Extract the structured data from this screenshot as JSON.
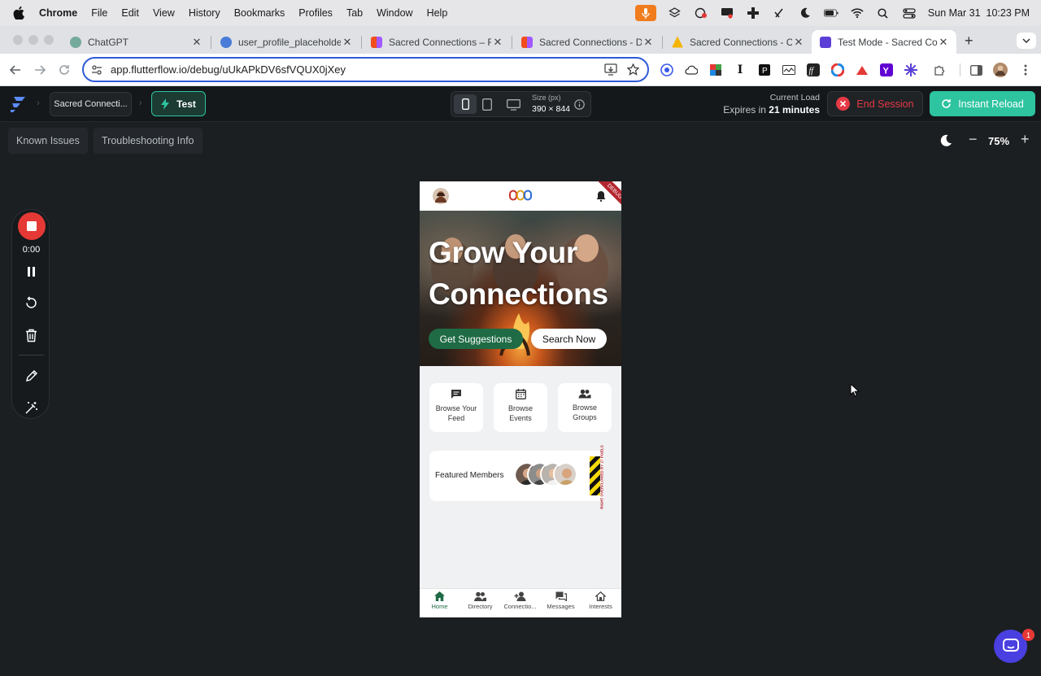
{
  "menubar": {
    "app": "Chrome",
    "items": [
      "File",
      "Edit",
      "View",
      "History",
      "Bookmarks",
      "Profiles",
      "Tab",
      "Window",
      "Help"
    ],
    "clock": "Sun Mar 31  10:23 PM"
  },
  "tabs": [
    {
      "title": "ChatGPT",
      "favicon_color": "#74aa9c"
    },
    {
      "title": "user_profile_placeholder.",
      "favicon_color": "#4a7bd8"
    },
    {
      "title": "Sacred Connections – Figma",
      "favicon_color": "#e2463a"
    },
    {
      "title": "Sacred Connections - Desi",
      "favicon_color": "#e2463a"
    },
    {
      "title": "Sacred Connections - Cloud",
      "favicon_color": "#f4b400"
    },
    {
      "title": "Test Mode - Sacred Conne",
      "favicon_color": "#5b3fd6",
      "active": true
    }
  ],
  "address_bar": {
    "url": "app.flutterflow.io/debug/uUkAPkDV6sfVQUX0jXey"
  },
  "ff_header": {
    "project_name": "Sacred Connecti...",
    "mode_label": "Test",
    "size_label": "Size (px)",
    "size_value": "390 × 844",
    "load_label": "Current Load",
    "expires_prefix": "Expires in",
    "expires_value": "21 minutes",
    "end_session": "End Session",
    "instant_reload": "Instant Reload"
  },
  "subbar": {
    "known_issues": "Known Issues",
    "troubleshooting": "Troubleshooting Info",
    "zoom": "75%"
  },
  "recorder": {
    "time": "0:00"
  },
  "phone": {
    "debug_ribbon": "DEBUG",
    "hero_title": "Grow Your Connections",
    "btn_suggestions": "Get Suggestions",
    "btn_search": "Search Now",
    "cards": [
      {
        "label": "Browse Your Feed",
        "icon": "chat-icon"
      },
      {
        "label": "Browse Events",
        "icon": "calendar-icon"
      },
      {
        "label": "Browse Groups",
        "icon": "group-icon"
      }
    ],
    "featured_label": "Featured Members",
    "overflow_text": "RIGHT OVERFLOWED BY 27 PIXELS",
    "nav": [
      {
        "label": "Home",
        "icon": "home-icon",
        "active": true
      },
      {
        "label": "Directory",
        "icon": "people-icon"
      },
      {
        "label": "Connectio...",
        "icon": "person-add-icon"
      },
      {
        "label": "Messages",
        "icon": "forum-icon"
      },
      {
        "label": "Interests",
        "icon": "house-icon"
      }
    ]
  },
  "chat_badge": "1",
  "colors": {
    "accent_green": "#2ec4a0",
    "brand_green": "#1f6b45",
    "danger": "#e53945"
  }
}
